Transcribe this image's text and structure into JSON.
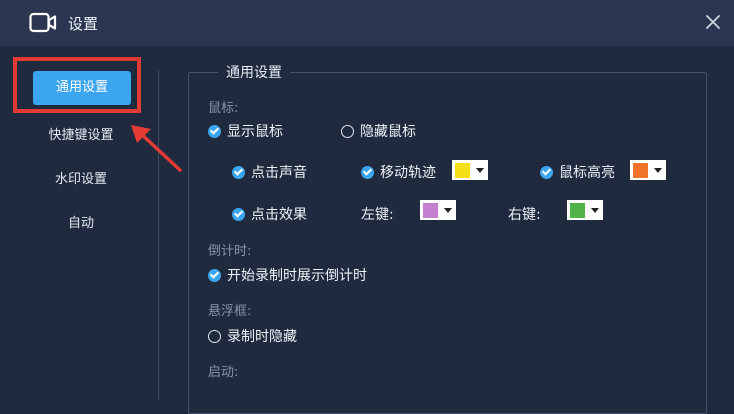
{
  "window": {
    "title": "设置",
    "close_icon": "close-icon",
    "app_icon": "video-camera-icon"
  },
  "sidebar": {
    "items": [
      {
        "label": "通用设置",
        "active": true
      },
      {
        "label": "快捷键设置"
      },
      {
        "label": "水印设置"
      },
      {
        "label": "自动"
      }
    ]
  },
  "group": {
    "title": "通用设置"
  },
  "mouse": {
    "section": "鼠标:",
    "show_cursor": "显示鼠标",
    "hide_cursor": "隐藏鼠标",
    "click_sound": "点击声音",
    "move_track": "移动轨迹",
    "move_track_color": "#f5e017",
    "cursor_highlight": "鼠标高亮",
    "cursor_highlight_color": "#f0752a",
    "click_effect": "点击效果",
    "left_key": "左键:",
    "left_key_color": "#c47fd0",
    "right_key": "右键:",
    "right_key_color": "#4fb347"
  },
  "countdown": {
    "section": "倒计时:",
    "show_countdown": "开始录制时展示倒计时"
  },
  "float": {
    "section": "悬浮框:",
    "hide_when_recording": "录制时隐藏"
  },
  "startup": {
    "section": "启动:"
  },
  "colors": {
    "accent": "#3ba6ef",
    "background": "#1f2a3f",
    "titlebar": "#2b3650",
    "highlight_box": "#e23b34"
  }
}
